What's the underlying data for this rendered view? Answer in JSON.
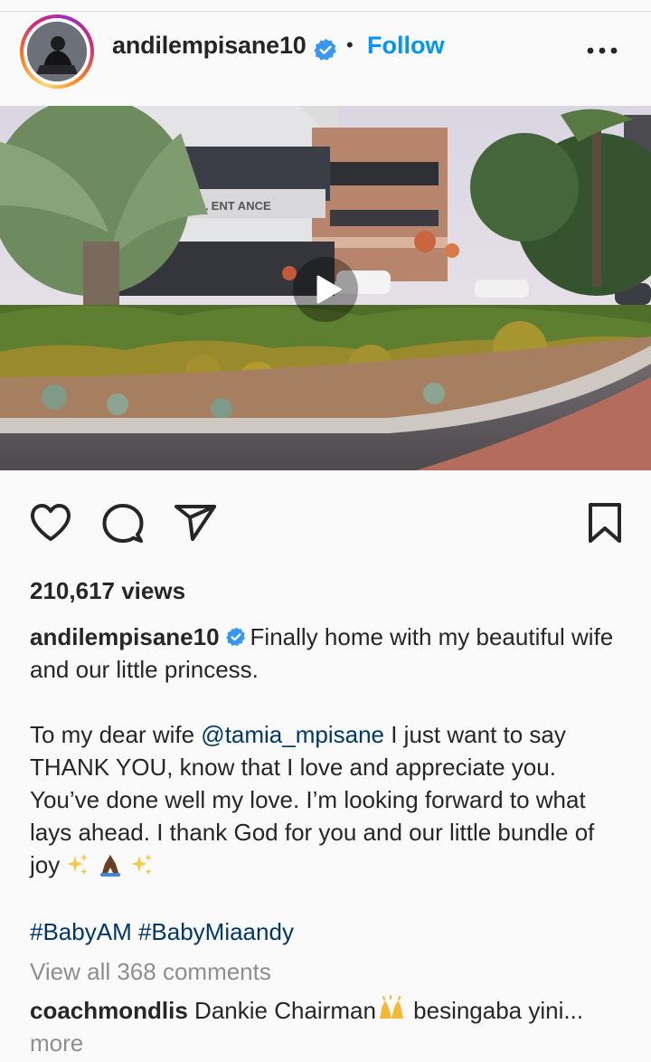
{
  "post": {
    "username": "andilempisane10",
    "follow_label": "Follow",
    "dot": "•",
    "views": "210,617 views",
    "caption": {
      "username": "andilempisane10",
      "line1": "Finally home with my beautiful wife and our little princess.",
      "p2_before": "To my dear wife ",
      "mention": "@tamia_mpisane",
      "p2_after": " I just want to say THANK YOU, know that I love and appreciate you. You’ve done well my love. I’m looking forward to what lays ahead. I thank God for you and our little bundle of joy "
    },
    "hashtags": "#BabyAM #BabyMiaandy",
    "view_all_comments": "View all 368 comments",
    "top_comment": {
      "username": "coachmondlis",
      "text_before": " Dankie Chairman",
      "text_after": " besingaba yini...",
      "more_label": " more"
    },
    "media_sign_text": "TAL ENT ANCE"
  },
  "colors": {
    "accent": "#0095f6",
    "verified": "#3897f0",
    "link": "#00376b",
    "muted": "#8e8e8e"
  },
  "icons": [
    "verified-badge-icon",
    "more-options-icon",
    "play-icon",
    "heart-icon",
    "comment-icon",
    "share-icon",
    "bookmark-icon"
  ]
}
